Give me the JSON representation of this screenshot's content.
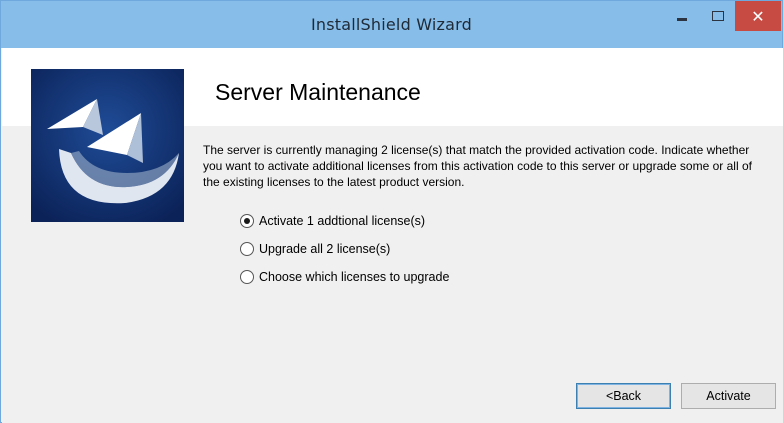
{
  "window": {
    "title": "InstallShield Wizard",
    "close_glyph": "✕"
  },
  "header": {
    "title": "Server Maintenance",
    "logo_icon": "installshield-logo-icon"
  },
  "description": "The server is currently managing 2 license(s) that match the provided activation code. Indicate whether you want to activate additional licenses from this activation code to this server or upgrade some or all of the existing licenses to the latest product version.",
  "options": [
    {
      "label": "Activate 1 addtional license(s)",
      "checked": true
    },
    {
      "label": "Upgrade all 2 license(s)",
      "checked": false
    },
    {
      "label": "Choose which licenses to upgrade",
      "checked": false
    }
  ],
  "buttons": {
    "back_label": "<Back",
    "activate_label": "Activate"
  },
  "colors": {
    "titlebar": "#87bde9",
    "close": "#c74b43",
    "logo_bg": "#0f2d67"
  }
}
